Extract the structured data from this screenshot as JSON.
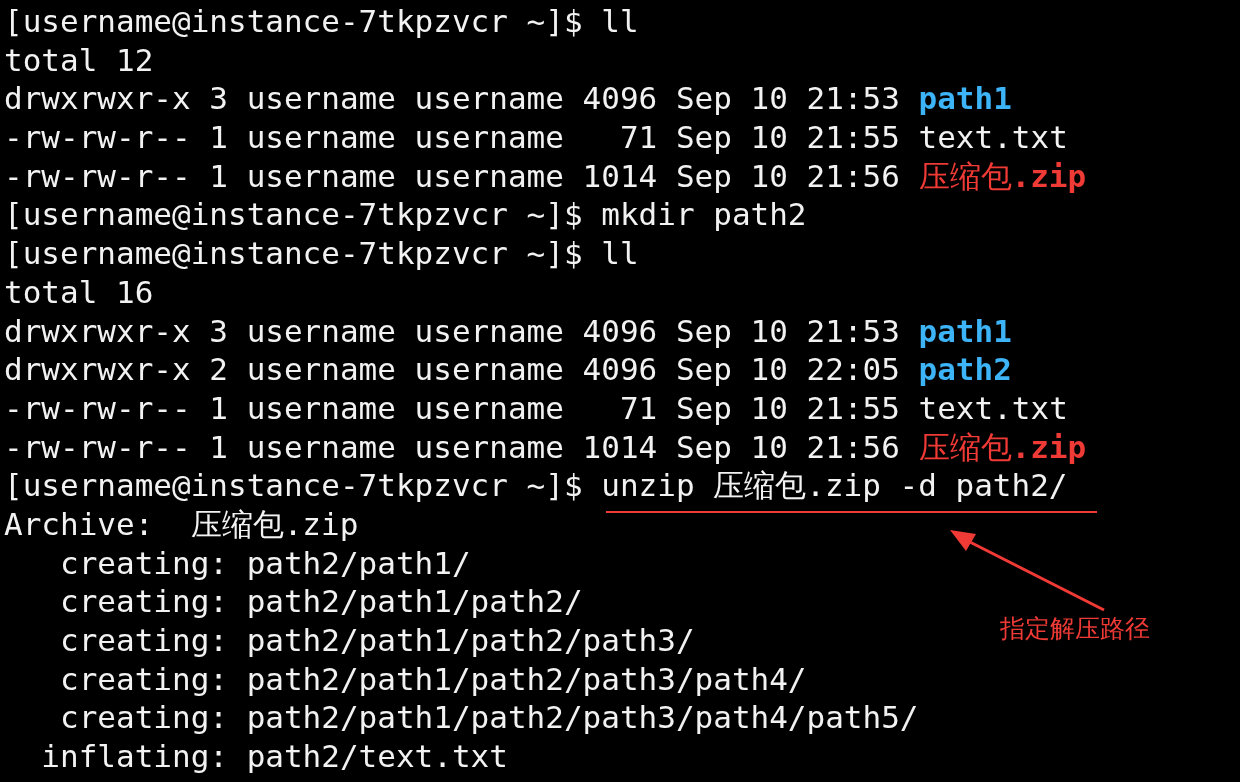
{
  "terminal": {
    "lines": [
      [
        {
          "kind": "plain",
          "text": "[username@instance-7tkpzvcr ~]$ ll"
        }
      ],
      [
        {
          "kind": "plain",
          "text": "total 12"
        }
      ],
      [
        {
          "kind": "plain",
          "text": "drwxrwxr-x 3 username username 4096 Sep 10 21:53 "
        },
        {
          "kind": "dir",
          "text": "path1"
        }
      ],
      [
        {
          "kind": "plain",
          "text": "-rw-rw-r-- 1 username username   71 Sep 10 21:55 text.txt"
        }
      ],
      [
        {
          "kind": "plain",
          "text": "-rw-rw-r-- 1 username username 1014 Sep 10 21:56 "
        },
        {
          "kind": "archive",
          "text": "压缩包**.zip**"
        }
      ],
      [
        {
          "kind": "plain",
          "text": "[username@instance-7tkpzvcr ~]$ mkdir path2"
        }
      ],
      [
        {
          "kind": "plain",
          "text": "[username@instance-7tkpzvcr ~]$ ll"
        }
      ],
      [
        {
          "kind": "plain",
          "text": "total 16"
        }
      ],
      [
        {
          "kind": "plain",
          "text": "drwxrwxr-x 3 username username 4096 Sep 10 21:53 "
        },
        {
          "kind": "dir",
          "text": "path1"
        }
      ],
      [
        {
          "kind": "plain",
          "text": "drwxrwxr-x 2 username username 4096 Sep 10 22:05 "
        },
        {
          "kind": "dir",
          "text": "path2"
        }
      ],
      [
        {
          "kind": "plain",
          "text": "-rw-rw-r-- 1 username username   71 Sep 10 21:55 text.txt"
        }
      ],
      [
        {
          "kind": "plain",
          "text": "-rw-rw-r-- 1 username username 1014 Sep 10 21:56 "
        },
        {
          "kind": "archive",
          "text": "压缩包**.zip**"
        }
      ],
      [
        {
          "kind": "plain",
          "text": "[username@instance-7tkpzvcr ~]$ "
        },
        {
          "kind": "highlighted",
          "text": "unzip 压缩包.zip -d path2/"
        }
      ],
      [
        {
          "kind": "plain",
          "text": "Archive:  压缩包.zip"
        }
      ],
      [
        {
          "kind": "plain",
          "text": "   creating: path2/path1/"
        }
      ],
      [
        {
          "kind": "plain",
          "text": "   creating: path2/path1/path2/"
        }
      ],
      [
        {
          "kind": "plain",
          "text": "   creating: path2/path1/path2/path3/"
        }
      ],
      [
        {
          "kind": "plain",
          "text": "   creating: path2/path1/path2/path3/path4/"
        }
      ],
      [
        {
          "kind": "plain",
          "text": "   creating: path2/path1/path2/path3/path4/path5/"
        }
      ],
      [
        {
          "kind": "plain",
          "text": "  inflating: path2/text.txt"
        }
      ]
    ]
  },
  "annotation": {
    "label": "指定解压路径"
  }
}
